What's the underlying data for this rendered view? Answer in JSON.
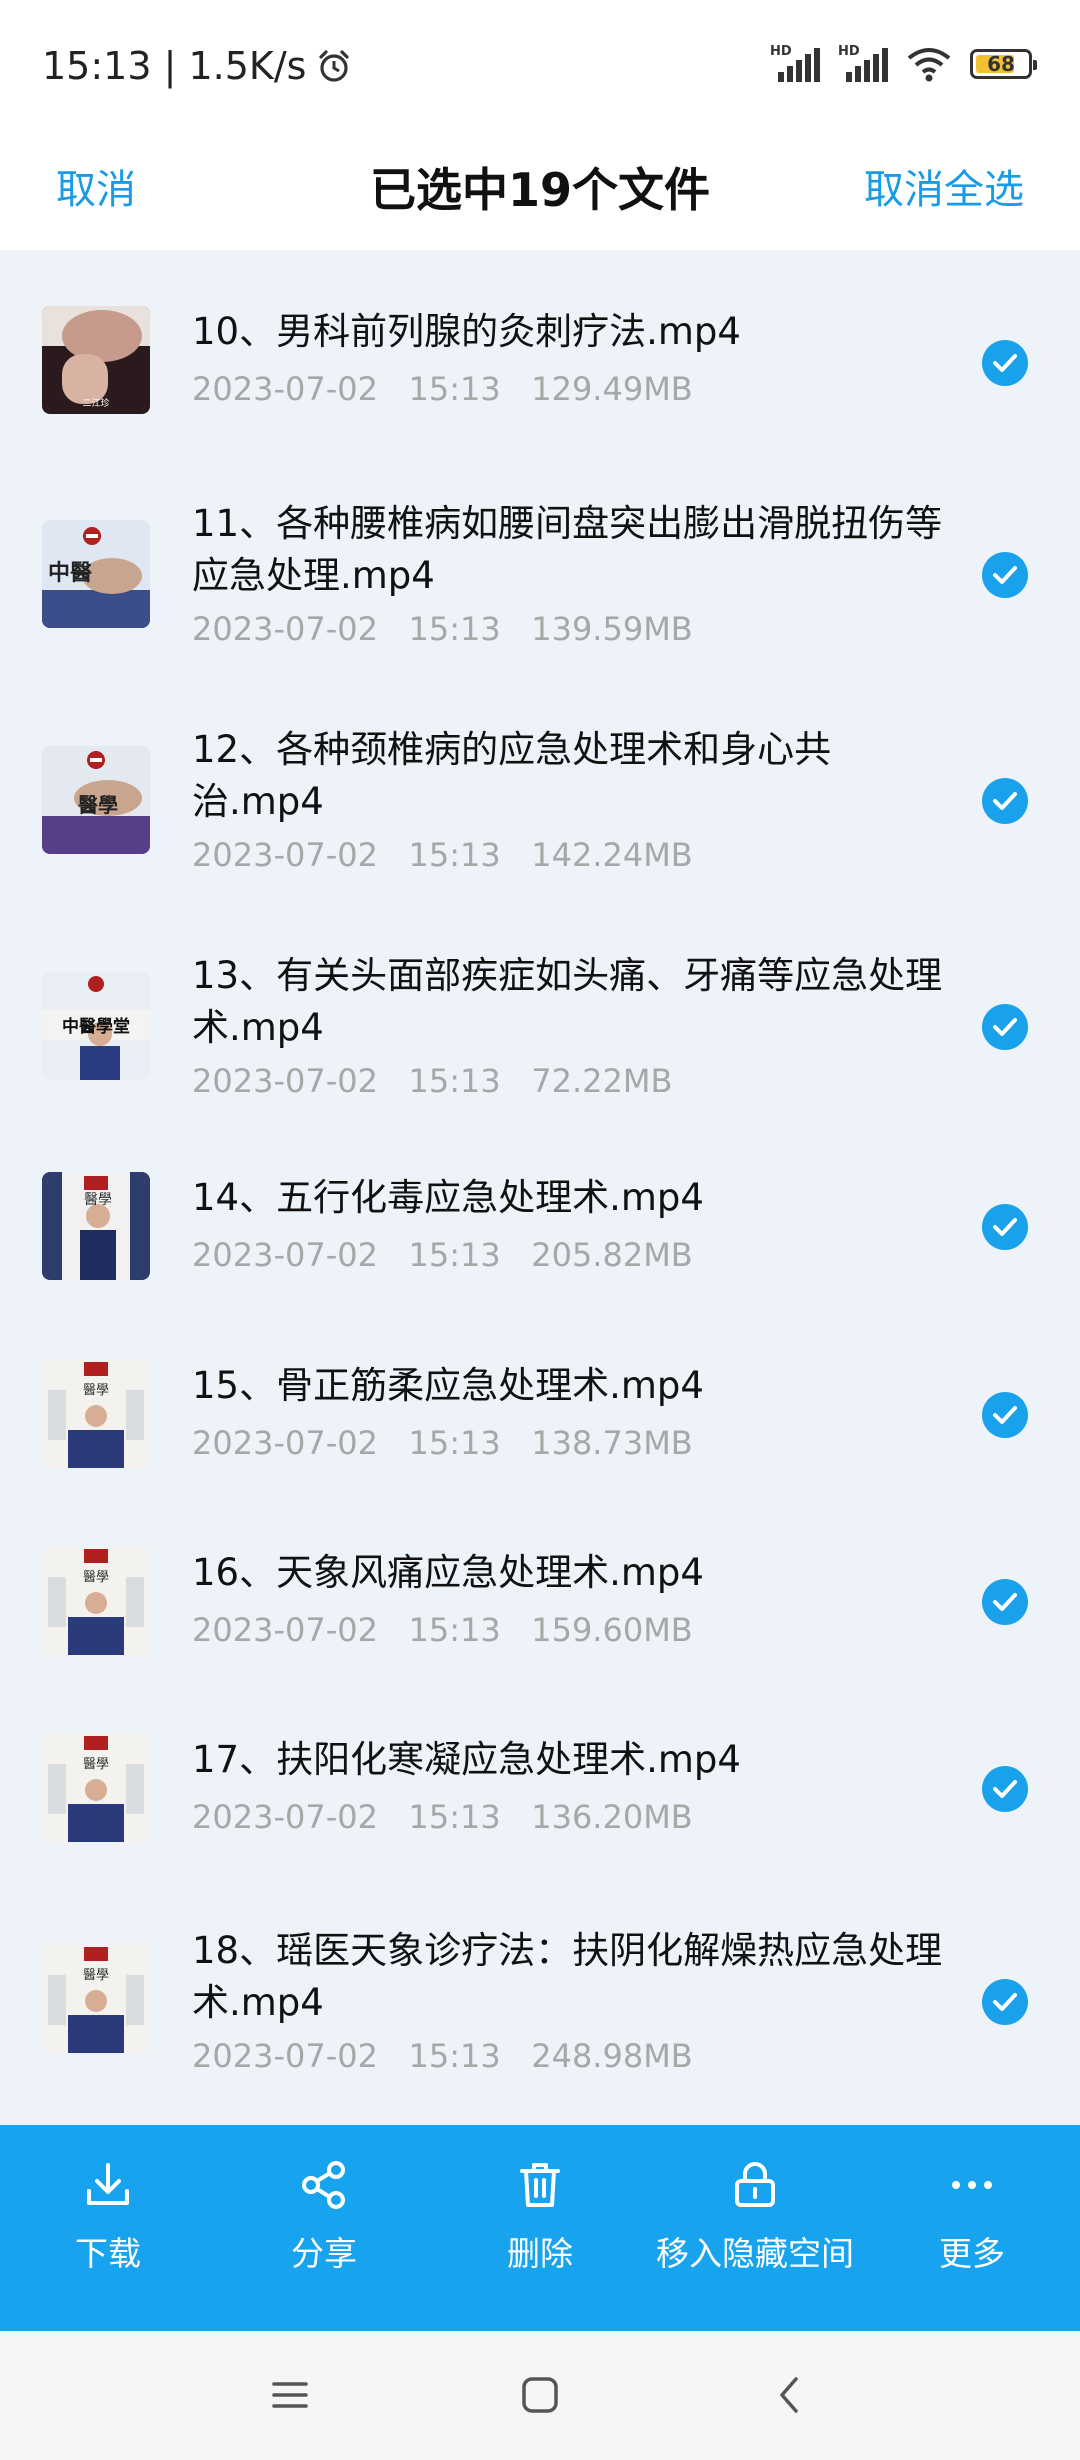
{
  "status_bar": {
    "time_speed": "15:13 | 1.5K/s",
    "battery": "68",
    "sim1": "HD",
    "sim2": "HD"
  },
  "header": {
    "cancel_label": "取消",
    "title": "已选中19个文件",
    "deselect_all_label": "取消全选"
  },
  "files": [
    {
      "name": "10、男科前列腺的灸刺疗法.mp4",
      "meta": "2023-07-02   15:13   129.49MB",
      "selected": true,
      "thumb_label": "二江珍"
    },
    {
      "name": "11、各种腰椎病如腰间盘突出膨出滑脱扭伤等应急处理.mp4",
      "meta": "2023-07-02   15:13   139.59MB",
      "selected": true,
      "thumb_label": "中醫"
    },
    {
      "name": "12、各种颈椎病的应急处理术和身心共治.mp4",
      "meta": "2023-07-02   15:13   142.24MB",
      "selected": true,
      "thumb_label": "醫學"
    },
    {
      "name": "13、有关头面部疾症如头痛、牙痛等应急处理术.mp4",
      "meta": "2023-07-02   15:13   72.22MB",
      "selected": true,
      "thumb_label": "中醫學堂"
    },
    {
      "name": "14、五行化毒应急处理术.mp4",
      "meta": "2023-07-02   15:13   205.82MB",
      "selected": true,
      "thumb_label": "醫學"
    },
    {
      "name": "15、骨正筋柔应急处理术.mp4",
      "meta": "2023-07-02   15:13   138.73MB",
      "selected": true,
      "thumb_label": "醫學"
    },
    {
      "name": "16、天象风痛应急处理术.mp4",
      "meta": "2023-07-02   15:13   159.60MB",
      "selected": true,
      "thumb_label": "醫學"
    },
    {
      "name": "17、扶阳化寒凝应急处理术.mp4",
      "meta": "2023-07-02   15:13   136.20MB",
      "selected": true,
      "thumb_label": "醫學"
    },
    {
      "name": "18、瑶医天象诊疗法：扶阴化解燥热应急处理术.mp4",
      "meta": "2023-07-02   15:13   248.98MB",
      "selected": true,
      "thumb_label": "醫學"
    }
  ],
  "actions": [
    {
      "label": "下载",
      "icon": "download-icon"
    },
    {
      "label": "分享",
      "icon": "share-icon"
    },
    {
      "label": "删除",
      "icon": "trash-icon"
    },
    {
      "label": "移入隐藏空间",
      "icon": "lock-icon"
    },
    {
      "label": "更多",
      "icon": "more-icon"
    }
  ],
  "nav": {
    "icons": [
      "menu-icon",
      "home-icon",
      "back-icon"
    ]
  },
  "colors": {
    "accent": "#1a9be6",
    "action_bar": "#17a3ee",
    "list_bg": "#eef3fa",
    "meta_text": "#a7a7a7"
  }
}
